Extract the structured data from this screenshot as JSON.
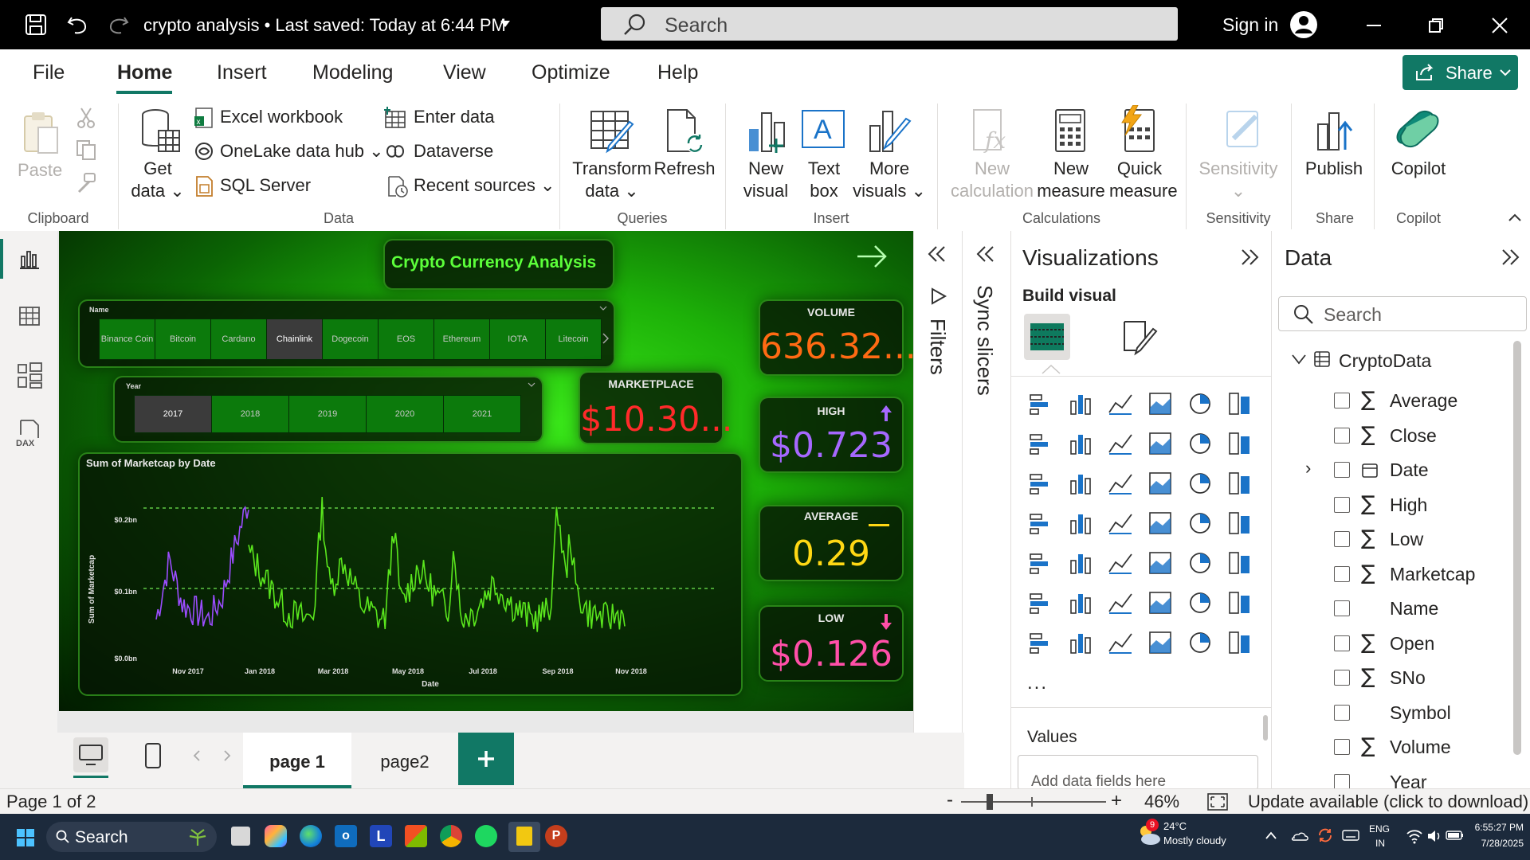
{
  "titlebar": {
    "doc_title": "crypto analysis  •  Last saved: Today at 6:44 PM",
    "search_placeholder": "Search",
    "signin": "Sign in"
  },
  "menu": {
    "items": [
      "File",
      "Home",
      "Insert",
      "Modeling",
      "View",
      "Optimize",
      "Help"
    ],
    "active": "Home",
    "share": "Share"
  },
  "ribbon": {
    "paste": "Paste",
    "get_data": [
      "Get",
      "data"
    ],
    "excel": "Excel workbook",
    "onelake": "OneLake data hub",
    "sql": "SQL Server",
    "enter_data": "Enter data",
    "dataverse": "Dataverse",
    "recent": "Recent sources",
    "transform": [
      "Transform",
      "data"
    ],
    "refresh": "Refresh",
    "new_visual": [
      "New",
      "visual"
    ],
    "text_box": [
      "Text",
      "box"
    ],
    "more_visuals": [
      "More",
      "visuals"
    ],
    "new_calc": [
      "New",
      "calculation"
    ],
    "new_measure": [
      "New",
      "measure"
    ],
    "quick_measure": [
      "Quick",
      "measure"
    ],
    "sensitivity": "Sensitivity",
    "publish": "Publish",
    "copilot": "Copilot",
    "groups": [
      "Clipboard",
      "Data",
      "Queries",
      "Insert",
      "Calculations",
      "Sensitivity",
      "Share",
      "Copilot"
    ]
  },
  "report": {
    "title": "Crypto Currency Analysis",
    "name_slicer": {
      "label": "Name",
      "items": [
        "Binance Coin",
        "Bitcoin",
        "Cardano",
        "Chainlink",
        "Dogecoin",
        "EOS",
        "Ethereum",
        "IOTA",
        "Litecoin"
      ],
      "selected": "Chainlink"
    },
    "year_slicer": {
      "label": "Year",
      "items": [
        "2017",
        "2018",
        "2019",
        "2020",
        "2021"
      ],
      "selected": "2017"
    },
    "kpis": {
      "volume": {
        "label": "VOLUME",
        "value": "636.32...",
        "color": "#ff6a13"
      },
      "marketplace": {
        "label": "MARKETPLACE",
        "value": "$10.30...",
        "color": "#ff2a2a"
      },
      "high": {
        "label": "HIGH",
        "value": "$0.723",
        "color": "#a668ff"
      },
      "average": {
        "label": "AVERAGE",
        "value": "0.29",
        "color": "#ffd814"
      },
      "low": {
        "label": "LOW",
        "value": "$0.126",
        "color": "#ff4fa8"
      }
    }
  },
  "chart_data": {
    "type": "line",
    "title": "Sum of Marketcap by Date",
    "xlabel": "Date",
    "ylabel": "Sum of Marketcap",
    "y_ticks": [
      "$0.0bn",
      "$0.1bn",
      "$0.2bn"
    ],
    "x_ticks": [
      "Nov 2017",
      "Jan 2018",
      "Mar 2018",
      "May 2018",
      "Jul 2018",
      "Sep 2018",
      "Nov 2018"
    ],
    "ylim": [
      0,
      0.2
    ],
    "grid": false,
    "series": [
      {
        "color": "#9b4dff",
        "x": [
          "2017-10",
          "2017-11",
          "2017-12",
          "2018-01"
        ],
        "y": [
          0.04,
          0.13,
          0.05,
          0.21
        ]
      },
      {
        "color": "#5ae61d",
        "x": [
          "2018-01",
          "2018-03",
          "2018-05",
          "2018-07",
          "2018-09",
          "2018-11"
        ],
        "y": [
          0.14,
          0.05,
          0.21,
          0.06,
          0.21,
          0.05
        ]
      }
    ]
  },
  "filters_label": "Filters",
  "sync_slicers_label": "Sync slicers",
  "viz": {
    "title": "Visualizations",
    "build_visual": "Build visual",
    "values_label": "Values",
    "add_fields": "Add data fields here",
    "more": "..."
  },
  "data_pane": {
    "title": "Data",
    "search_placeholder": "Search",
    "table": "CryptoData",
    "fields": [
      {
        "name": "Average",
        "sigma": true
      },
      {
        "name": "Close",
        "sigma": true
      },
      {
        "name": "Date",
        "sigma": false,
        "calendar": true
      },
      {
        "name": "High",
        "sigma": true
      },
      {
        "name": "Low",
        "sigma": true
      },
      {
        "name": "Marketcap",
        "sigma": true
      },
      {
        "name": "Name",
        "sigma": false
      },
      {
        "name": "Open",
        "sigma": true
      },
      {
        "name": "SNo",
        "sigma": true
      },
      {
        "name": "Symbol",
        "sigma": false
      },
      {
        "name": "Volume",
        "sigma": true
      },
      {
        "name": "Year",
        "sigma": false
      }
    ]
  },
  "pages": [
    "page 1",
    "page2"
  ],
  "status": {
    "page": "Page 1 of 2",
    "zoom": "46%",
    "update": "Update available (click to download)"
  },
  "taskbar": {
    "search": "Search",
    "weather_temp": "24°C",
    "weather_desc": "Mostly cloudy",
    "weather_badge": "9",
    "lang": "ENG",
    "lang2": "IN",
    "time": "6:55:27 PM",
    "date": "7/28/2025"
  }
}
